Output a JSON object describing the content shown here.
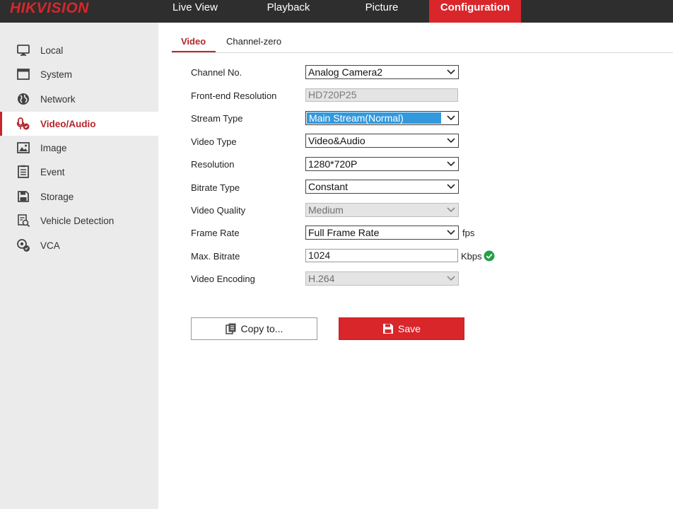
{
  "header": {
    "logo": "HIKVISION",
    "nav": [
      {
        "label": "Live View"
      },
      {
        "label": "Playback"
      },
      {
        "label": "Picture"
      },
      {
        "label": "Configuration",
        "active": true
      }
    ]
  },
  "sidebar": {
    "items": [
      {
        "label": "Local",
        "icon": "monitor-icon"
      },
      {
        "label": "System",
        "icon": "window-icon"
      },
      {
        "label": "Network",
        "icon": "globe-icon"
      },
      {
        "label": "Video/Audio",
        "icon": "camera-mic-icon",
        "active": true
      },
      {
        "label": "Image",
        "icon": "image-icon"
      },
      {
        "label": "Event",
        "icon": "event-list-icon"
      },
      {
        "label": "Storage",
        "icon": "storage-icon"
      },
      {
        "label": "Vehicle Detection",
        "icon": "vehicle-detection-icon"
      },
      {
        "label": "VCA",
        "icon": "vca-icon"
      }
    ]
  },
  "tabs": [
    {
      "label": "Video",
      "active": true
    },
    {
      "label": "Channel-zero"
    }
  ],
  "form": {
    "channel_no": {
      "label": "Channel No.",
      "value": "Analog Camera2"
    },
    "front_end_resolution": {
      "label": "Front-end Resolution",
      "value": "HD720P25"
    },
    "stream_type": {
      "label": "Stream Type",
      "value": "Main Stream(Normal)"
    },
    "video_type": {
      "label": "Video Type",
      "value": "Video&Audio"
    },
    "resolution": {
      "label": "Resolution",
      "value": "1280*720P"
    },
    "bitrate_type": {
      "label": "Bitrate Type",
      "value": "Constant"
    },
    "video_quality": {
      "label": "Video Quality",
      "value": "Medium"
    },
    "frame_rate": {
      "label": "Frame Rate",
      "value": "Full Frame Rate",
      "unit": "fps"
    },
    "max_bitrate": {
      "label": "Max. Bitrate",
      "value": "1024",
      "unit": "Kbps"
    },
    "video_encoding": {
      "label": "Video Encoding",
      "value": "H.264"
    }
  },
  "buttons": {
    "copy_label": "Copy to...",
    "save_label": "Save"
  },
  "colors": {
    "accent": "#d9262b",
    "topbar": "#2e2e2e",
    "sidebar": "#ebebeb",
    "valid": "#22a045",
    "selection": "#3399dd"
  }
}
